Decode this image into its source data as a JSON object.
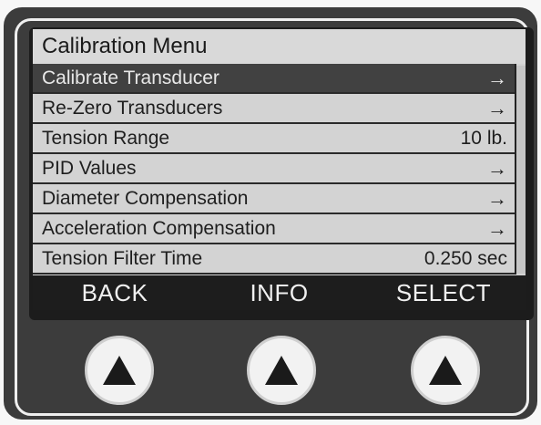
{
  "screen": {
    "title": "Calibration Menu",
    "rows": [
      {
        "label": "Calibrate Transducer",
        "value": "→"
      },
      {
        "label": "Re-Zero Transducers",
        "value": "→"
      },
      {
        "label": "Tension Range",
        "value": "10 lb."
      },
      {
        "label": "PID Values",
        "value": "→"
      },
      {
        "label": "Diameter Compensation",
        "value": "→"
      },
      {
        "label": "Acceleration Compensation",
        "value": "→"
      },
      {
        "label": "Tension Filter Time",
        "value": "0.250 sec"
      }
    ],
    "selected_row": "Calibrate Transducer"
  },
  "softkeys": {
    "back": "BACK",
    "info": "INFO",
    "select": "SELECT"
  },
  "hardware_buttons": [
    {
      "name": "left-softkey-button",
      "icon": "up-triangle-icon"
    },
    {
      "name": "middle-softkey-button",
      "icon": "up-triangle-icon"
    },
    {
      "name": "right-softkey-button",
      "icon": "up-triangle-icon"
    }
  ],
  "colors": {
    "screen_bg": "#d3d3d3",
    "selected_bg": "#414141",
    "softkey_bar_bg": "#1d1d1d",
    "housing": "#3c3c3c"
  }
}
